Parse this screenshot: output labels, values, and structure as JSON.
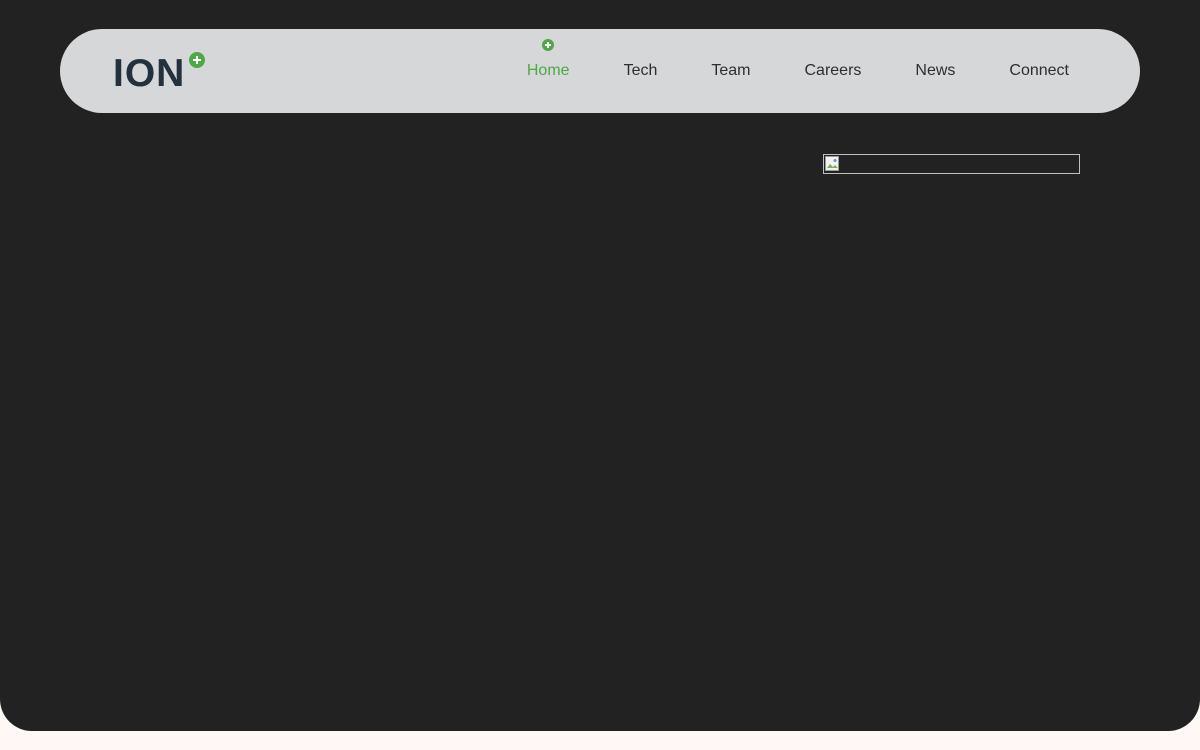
{
  "brand": {
    "logo_text": "ION",
    "logo_icon": "plus-circle-icon",
    "accent_color": "#4ea845",
    "text_color": "#23303d"
  },
  "nav": {
    "active_index": 0,
    "active_marker_icon": "plus-circle-icon",
    "items": [
      {
        "label": "Home"
      },
      {
        "label": "Tech"
      },
      {
        "label": "Team"
      },
      {
        "label": "Careers"
      },
      {
        "label": "News"
      },
      {
        "label": "Connect"
      }
    ]
  },
  "hero": {
    "background_color": "#222222",
    "image_icon": "broken-image-icon"
  }
}
